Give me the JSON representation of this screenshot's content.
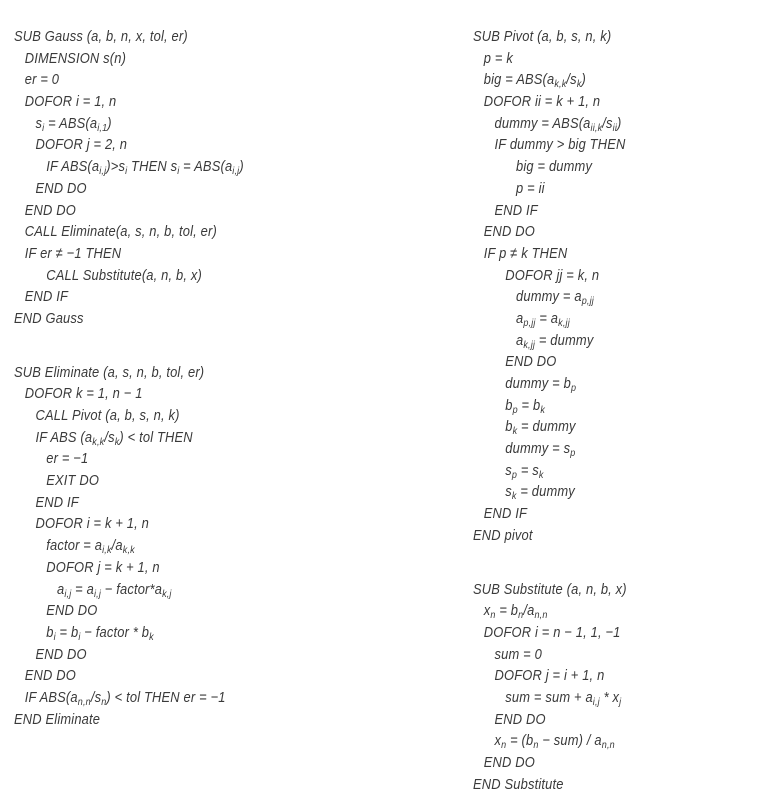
{
  "left_column": {
    "gauss": {
      "name": "Gauss",
      "lines": [
        {
          "indent": 0,
          "text": "SUB Gauss (a, b, n, x, tol, er)"
        },
        {
          "indent": 1,
          "text": "DIMENSION s(n)"
        },
        {
          "indent": 1,
          "text": "er = 0"
        },
        {
          "indent": 1,
          "text": "DOFOR i = 1, n"
        },
        {
          "indent": 2,
          "html": "s<sub>i</sub> = ABS(a<sub>i,1</sub>)"
        },
        {
          "indent": 2,
          "text": "DOFOR j = 2, n"
        },
        {
          "indent": 3,
          "html": "IF ABS(a<sub>i,j</sub>)&gt;s<sub>i</sub> THEN s<sub>i</sub> = ABS(a<sub>i,j</sub>)"
        },
        {
          "indent": 2,
          "text": "END DO"
        },
        {
          "indent": 1,
          "text": "END DO"
        },
        {
          "indent": 1,
          "text": "CALL Eliminate(a, s, n, b, tol, er)"
        },
        {
          "indent": 1,
          "text": "IF er ≠ −1 THEN"
        },
        {
          "indent": 3,
          "text": "CALL Substitute(a, n, b, x)"
        },
        {
          "indent": 1,
          "text": "END IF"
        },
        {
          "indent": 0,
          "text": "END Gauss"
        }
      ]
    },
    "eliminate": {
      "name": "Eliminate",
      "lines": [
        {
          "indent": 0,
          "text": "SUB Eliminate (a, s, n, b, tol, er)"
        },
        {
          "indent": 1,
          "text": "DOFOR k = 1, n − 1"
        },
        {
          "indent": 2,
          "text": "CALL Pivot (a, b, s, n, k)"
        },
        {
          "indent": 2,
          "html": "IF ABS (a<sub>k,k</sub>/s<sub>k</sub>) &lt; tol THEN"
        },
        {
          "indent": 3,
          "text": "er = −1"
        },
        {
          "indent": 3,
          "text": "EXIT DO"
        },
        {
          "indent": 2,
          "text": "END IF"
        },
        {
          "indent": 2,
          "text": "DOFOR i = k + 1, n"
        },
        {
          "indent": 3,
          "html": "factor = a<sub>i,k</sub>/a<sub>k,k</sub>"
        },
        {
          "indent": 3,
          "text": "DOFOR j = k + 1, n"
        },
        {
          "indent": 4,
          "html": "a<sub>i,j</sub> = a<sub>i,j</sub> − factor*a<sub>k,j</sub>"
        },
        {
          "indent": 3,
          "text": "END DO"
        },
        {
          "indent": 3,
          "html": "b<sub>i</sub> = b<sub>i</sub> − factor * b<sub>k</sub>"
        },
        {
          "indent": 2,
          "text": "END DO"
        },
        {
          "indent": 1,
          "text": "END DO"
        },
        {
          "indent": 1,
          "html": "IF ABS(a<sub>n,n</sub>/s<sub>n</sub>) &lt; tol THEN er = −1"
        },
        {
          "indent": 0,
          "text": "END Eliminate"
        }
      ]
    }
  },
  "right_column": {
    "pivot": {
      "name": "Pivot",
      "lines": [
        {
          "indent": 0,
          "text": "SUB Pivot (a, b, s, n, k)"
        },
        {
          "indent": 1,
          "text": "p = k"
        },
        {
          "indent": 1,
          "html": "big = ABS(a<sub>k,k</sub>/s<sub>k</sub>)"
        },
        {
          "indent": 1,
          "text": "DOFOR ii = k + 1, n"
        },
        {
          "indent": 2,
          "html": "dummy = ABS(a<sub>ii,k</sub>/s<sub>ii</sub>)"
        },
        {
          "indent": 2,
          "text": "IF dummy > big THEN"
        },
        {
          "indent": 4,
          "text": "big = dummy"
        },
        {
          "indent": 4,
          "text": "p = ii"
        },
        {
          "indent": 2,
          "text": "END IF"
        },
        {
          "indent": 1,
          "text": "END DO"
        },
        {
          "indent": 1,
          "text": "IF p ≠ k THEN"
        },
        {
          "indent": 3,
          "text": "DOFOR jj = k, n"
        },
        {
          "indent": 4,
          "html": "dummy = a<sub>p,jj</sub>"
        },
        {
          "indent": 4,
          "html": "a<sub>p,jj</sub> = a<sub>k,jj</sub>"
        },
        {
          "indent": 4,
          "html": "a<sub>k,jj</sub> = dummy"
        },
        {
          "indent": 3,
          "text": "END DO"
        },
        {
          "indent": 3,
          "html": "dummy = b<sub>p</sub>"
        },
        {
          "indent": 3,
          "html": "b<sub>p</sub> = b<sub>k</sub>"
        },
        {
          "indent": 3,
          "html": "b<sub>k</sub> = dummy"
        },
        {
          "indent": 3,
          "html": "dummy = s<sub>p</sub>"
        },
        {
          "indent": 3,
          "html": "s<sub>p</sub> = s<sub>k</sub>"
        },
        {
          "indent": 3,
          "html": "s<sub>k</sub> = dummy"
        },
        {
          "indent": 1,
          "text": "END IF"
        },
        {
          "indent": 0,
          "text": "END pivot"
        }
      ]
    },
    "substitute": {
      "name": "Substitute",
      "lines": [
        {
          "indent": 0,
          "text": "SUB Substitute (a, n, b, x)"
        },
        {
          "indent": 1,
          "html": "x<sub>n</sub> = b<sub>n</sub>/a<sub>n,n</sub>"
        },
        {
          "indent": 1,
          "text": "DOFOR i = n − 1, 1, −1"
        },
        {
          "indent": 2,
          "text": "sum = 0"
        },
        {
          "indent": 2,
          "text": "DOFOR j = i + 1, n"
        },
        {
          "indent": 3,
          "html": "sum = sum + a<sub>i,j</sub> * x<sub>j</sub>"
        },
        {
          "indent": 2,
          "text": "END DO"
        },
        {
          "indent": 2,
          "html": "x<sub>n</sub> = (b<sub>n</sub> − sum) / a<sub>n,n</sub>"
        },
        {
          "indent": 1,
          "text": "END DO"
        },
        {
          "indent": 0,
          "text": "END Substitute"
        }
      ]
    }
  }
}
